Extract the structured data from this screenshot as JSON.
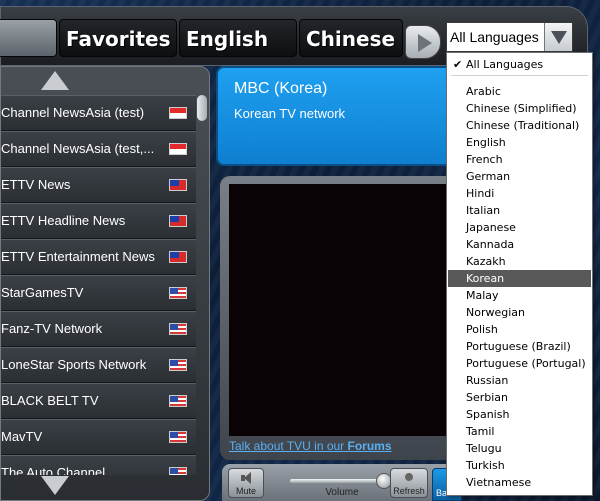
{
  "tabs": [
    {
      "label": ""
    },
    {
      "label": "Favorites"
    },
    {
      "label": "English"
    },
    {
      "label": "Chinese"
    }
  ],
  "language_select": {
    "value": "All Languages"
  },
  "channels": [
    {
      "name": "Channel NewsAsia (test)",
      "flag": "singapore-flag-icon"
    },
    {
      "name": "Channel NewsAsia (test,...",
      "flag": "singapore-flag-icon"
    },
    {
      "name": "ETTV News",
      "flag": "taiwan-flag-icon"
    },
    {
      "name": "ETTV Headline News",
      "flag": "taiwan-flag-icon"
    },
    {
      "name": "ETTV Entertainment News",
      "flag": "taiwan-flag-icon"
    },
    {
      "name": "StarGamesTV",
      "flag": "usa-flag-icon"
    },
    {
      "name": "Fanz-TV Network",
      "flag": "usa-flag-icon"
    },
    {
      "name": "LoneStar Sports Network",
      "flag": "usa-flag-icon"
    },
    {
      "name": "BLACK BELT TV",
      "flag": "usa-flag-icon"
    },
    {
      "name": "MavTV",
      "flag": "usa-flag-icon"
    },
    {
      "name": "The Auto Channel",
      "flag": "usa-flag-icon"
    }
  ],
  "channel_info": {
    "title": "MBC (Korea)",
    "description": "Korean TV network"
  },
  "video": {
    "forums_prefix": "Talk about TVU in our ",
    "forums_link": "Forums"
  },
  "controls": {
    "mute_label": "Mute",
    "volume_label": "Volume",
    "volume_level": 0.9,
    "refresh_label": "Refresh",
    "partial_label": "Ban"
  },
  "dropdown": {
    "selected": "All Languages",
    "highlighted": "Korean",
    "items": [
      "All Languages",
      "Arabic",
      "Chinese (Simplified)",
      "Chinese (Traditional)",
      "English",
      "French",
      "German",
      "Hindi",
      "Italian",
      "Japanese",
      "Kannada",
      "Kazakh",
      "Korean",
      "Malay",
      "Norwegian",
      "Polish",
      "Portuguese (Brazil)",
      "Portuguese (Portugal)",
      "Russian",
      "Serbian",
      "Spanish",
      "Tamil",
      "Telugu",
      "Turkish",
      "Vietnamese"
    ]
  },
  "colors": {
    "info_panel": "#1fa0f0",
    "link": "#5aaff2",
    "highlight": "#595959"
  }
}
